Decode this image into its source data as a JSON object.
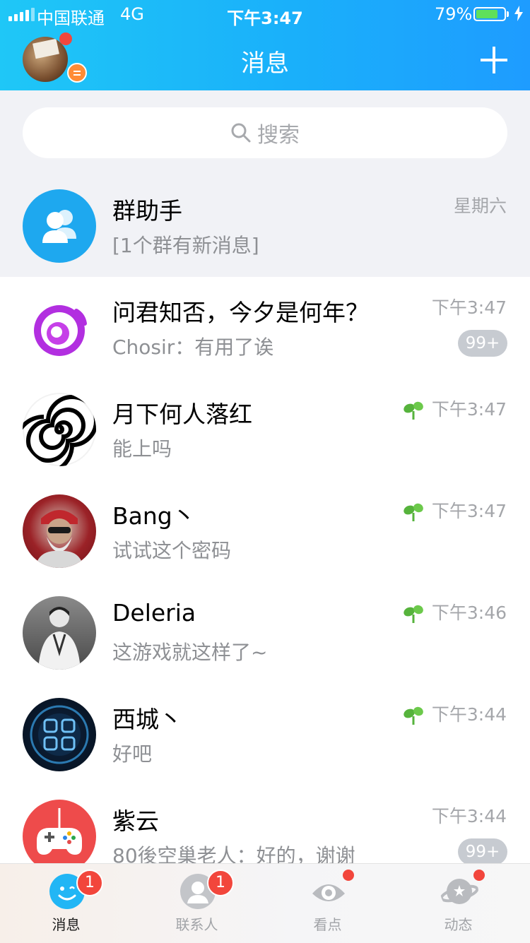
{
  "status_bar": {
    "carrier": "中国联通",
    "network": "4G",
    "time": "下午3:47",
    "battery": "79%",
    "battery_level": 0.79
  },
  "header": {
    "title": "消息"
  },
  "search": {
    "placeholder": "搜索"
  },
  "group_helper": {
    "name": "群助手",
    "message": "[1个群有新消息]",
    "time": "星期六"
  },
  "chats": [
    {
      "name": "问君知否，今夕是何年？",
      "message": "Chosir：有用了诶",
      "time": "下午3:47",
      "badge": "99+",
      "sprout": false
    },
    {
      "name": "月下何人落红",
      "message": "能上吗",
      "time": "下午3:47",
      "badge": "",
      "sprout": true
    },
    {
      "name": "Bang丶",
      "message": "试试这个密码",
      "time": "下午3:47",
      "badge": "",
      "sprout": true
    },
    {
      "name": "Deleria",
      "message": "这游戏就这样了~",
      "time": "下午3:46",
      "badge": "",
      "sprout": true
    },
    {
      "name": "西城丶",
      "message": "好吧",
      "time": "下午3:44",
      "badge": "",
      "sprout": true
    },
    {
      "name": "紫云",
      "message": "80後空巢老人：好的，谢谢",
      "time": "下午3:44",
      "badge": "99+",
      "sprout": false
    }
  ],
  "tabs": [
    {
      "label": "消息",
      "badge": "1",
      "active": true,
      "icon": "chat-bubble-icon"
    },
    {
      "label": "联系人",
      "badge": "1",
      "active": false,
      "icon": "contacts-icon"
    },
    {
      "label": "看点",
      "badge": "",
      "active": false,
      "icon": "eye-icon"
    },
    {
      "label": "动态",
      "badge": "",
      "active": false,
      "icon": "planet-icon"
    }
  ],
  "colors": {
    "header_start": "#1fc7f7",
    "header_end": "#1e9cff",
    "badge_red": "#f2463c",
    "group_helper_blue": "#1ea8ef"
  }
}
